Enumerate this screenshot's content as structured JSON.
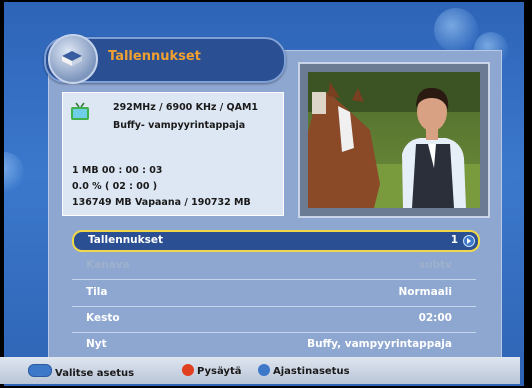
{
  "header": {
    "title": "Tallennukset"
  },
  "info": {
    "line1": "292MHz / 6900 KHz / QAM1",
    "line2": "Buffy- vampyyrintappaja",
    "line3": "1 MB 00 : 00 : 03",
    "line4": "0.0 % ( 02 : 00 )",
    "line5": "136749 MB Vapaana / 190732 MB"
  },
  "menu": {
    "rows": [
      {
        "label": "Tallennukset",
        "value": "1",
        "selected": true
      },
      {
        "label": "Kanava",
        "value": "subtv",
        "disabled": true
      },
      {
        "label": "Tila",
        "value": "Normaali"
      },
      {
        "label": "Kesto",
        "value": "02:00"
      },
      {
        "label": "Nyt",
        "value": "Buffy, vampyyrintappaja"
      }
    ]
  },
  "footer": {
    "select_label": "Valitse asetus",
    "stop_label": "Pysäytä",
    "timer_label": "Ajastinasetus"
  },
  "colors": {
    "accent": "#f0d84a",
    "title": "#f2a030",
    "stop": "#e04020",
    "timer": "#3e78c8"
  }
}
